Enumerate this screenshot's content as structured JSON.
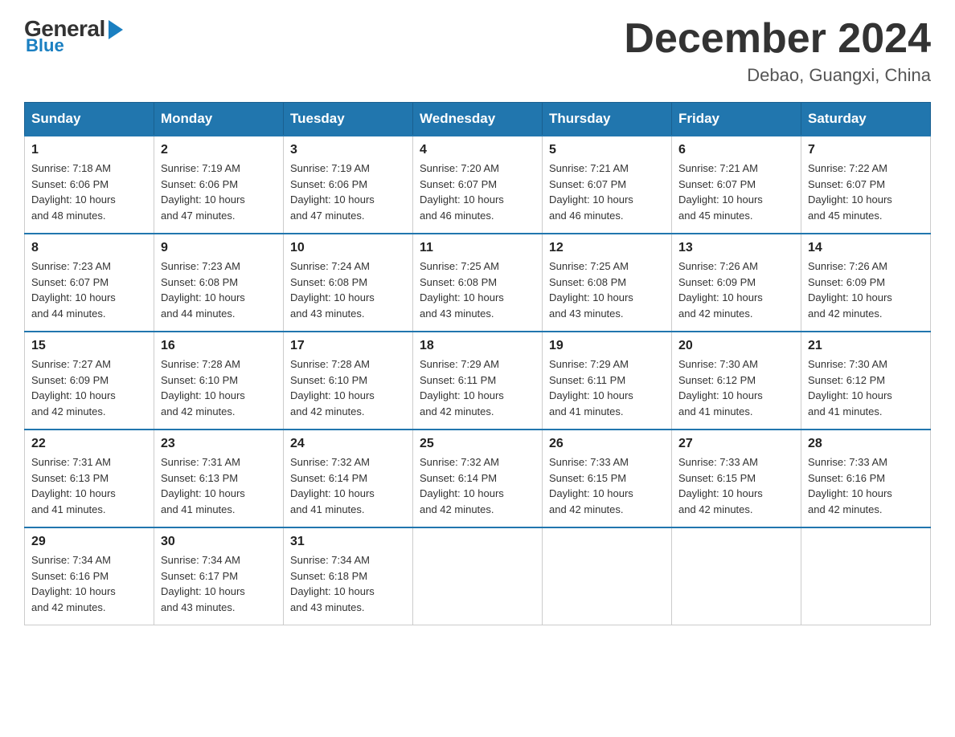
{
  "header": {
    "logo_general": "General",
    "logo_blue": "Blue",
    "month_title": "December 2024",
    "location": "Debao, Guangxi, China"
  },
  "days_of_week": [
    "Sunday",
    "Monday",
    "Tuesday",
    "Wednesday",
    "Thursday",
    "Friday",
    "Saturday"
  ],
  "weeks": [
    [
      {
        "day": "1",
        "info": "Sunrise: 7:18 AM\nSunset: 6:06 PM\nDaylight: 10 hours\nand 48 minutes."
      },
      {
        "day": "2",
        "info": "Sunrise: 7:19 AM\nSunset: 6:06 PM\nDaylight: 10 hours\nand 47 minutes."
      },
      {
        "day": "3",
        "info": "Sunrise: 7:19 AM\nSunset: 6:06 PM\nDaylight: 10 hours\nand 47 minutes."
      },
      {
        "day": "4",
        "info": "Sunrise: 7:20 AM\nSunset: 6:07 PM\nDaylight: 10 hours\nand 46 minutes."
      },
      {
        "day": "5",
        "info": "Sunrise: 7:21 AM\nSunset: 6:07 PM\nDaylight: 10 hours\nand 46 minutes."
      },
      {
        "day": "6",
        "info": "Sunrise: 7:21 AM\nSunset: 6:07 PM\nDaylight: 10 hours\nand 45 minutes."
      },
      {
        "day": "7",
        "info": "Sunrise: 7:22 AM\nSunset: 6:07 PM\nDaylight: 10 hours\nand 45 minutes."
      }
    ],
    [
      {
        "day": "8",
        "info": "Sunrise: 7:23 AM\nSunset: 6:07 PM\nDaylight: 10 hours\nand 44 minutes."
      },
      {
        "day": "9",
        "info": "Sunrise: 7:23 AM\nSunset: 6:08 PM\nDaylight: 10 hours\nand 44 minutes."
      },
      {
        "day": "10",
        "info": "Sunrise: 7:24 AM\nSunset: 6:08 PM\nDaylight: 10 hours\nand 43 minutes."
      },
      {
        "day": "11",
        "info": "Sunrise: 7:25 AM\nSunset: 6:08 PM\nDaylight: 10 hours\nand 43 minutes."
      },
      {
        "day": "12",
        "info": "Sunrise: 7:25 AM\nSunset: 6:08 PM\nDaylight: 10 hours\nand 43 minutes."
      },
      {
        "day": "13",
        "info": "Sunrise: 7:26 AM\nSunset: 6:09 PM\nDaylight: 10 hours\nand 42 minutes."
      },
      {
        "day": "14",
        "info": "Sunrise: 7:26 AM\nSunset: 6:09 PM\nDaylight: 10 hours\nand 42 minutes."
      }
    ],
    [
      {
        "day": "15",
        "info": "Sunrise: 7:27 AM\nSunset: 6:09 PM\nDaylight: 10 hours\nand 42 minutes."
      },
      {
        "day": "16",
        "info": "Sunrise: 7:28 AM\nSunset: 6:10 PM\nDaylight: 10 hours\nand 42 minutes."
      },
      {
        "day": "17",
        "info": "Sunrise: 7:28 AM\nSunset: 6:10 PM\nDaylight: 10 hours\nand 42 minutes."
      },
      {
        "day": "18",
        "info": "Sunrise: 7:29 AM\nSunset: 6:11 PM\nDaylight: 10 hours\nand 42 minutes."
      },
      {
        "day": "19",
        "info": "Sunrise: 7:29 AM\nSunset: 6:11 PM\nDaylight: 10 hours\nand 41 minutes."
      },
      {
        "day": "20",
        "info": "Sunrise: 7:30 AM\nSunset: 6:12 PM\nDaylight: 10 hours\nand 41 minutes."
      },
      {
        "day": "21",
        "info": "Sunrise: 7:30 AM\nSunset: 6:12 PM\nDaylight: 10 hours\nand 41 minutes."
      }
    ],
    [
      {
        "day": "22",
        "info": "Sunrise: 7:31 AM\nSunset: 6:13 PM\nDaylight: 10 hours\nand 41 minutes."
      },
      {
        "day": "23",
        "info": "Sunrise: 7:31 AM\nSunset: 6:13 PM\nDaylight: 10 hours\nand 41 minutes."
      },
      {
        "day": "24",
        "info": "Sunrise: 7:32 AM\nSunset: 6:14 PM\nDaylight: 10 hours\nand 41 minutes."
      },
      {
        "day": "25",
        "info": "Sunrise: 7:32 AM\nSunset: 6:14 PM\nDaylight: 10 hours\nand 42 minutes."
      },
      {
        "day": "26",
        "info": "Sunrise: 7:33 AM\nSunset: 6:15 PM\nDaylight: 10 hours\nand 42 minutes."
      },
      {
        "day": "27",
        "info": "Sunrise: 7:33 AM\nSunset: 6:15 PM\nDaylight: 10 hours\nand 42 minutes."
      },
      {
        "day": "28",
        "info": "Sunrise: 7:33 AM\nSunset: 6:16 PM\nDaylight: 10 hours\nand 42 minutes."
      }
    ],
    [
      {
        "day": "29",
        "info": "Sunrise: 7:34 AM\nSunset: 6:16 PM\nDaylight: 10 hours\nand 42 minutes."
      },
      {
        "day": "30",
        "info": "Sunrise: 7:34 AM\nSunset: 6:17 PM\nDaylight: 10 hours\nand 43 minutes."
      },
      {
        "day": "31",
        "info": "Sunrise: 7:34 AM\nSunset: 6:18 PM\nDaylight: 10 hours\nand 43 minutes."
      },
      {
        "day": "",
        "info": ""
      },
      {
        "day": "",
        "info": ""
      },
      {
        "day": "",
        "info": ""
      },
      {
        "day": "",
        "info": ""
      }
    ]
  ]
}
